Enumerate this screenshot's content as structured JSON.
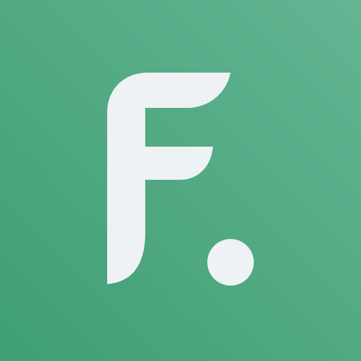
{
  "app_icon": {
    "name": "app-logo",
    "glyph": "F.",
    "colors": {
      "background_start": "#3f9e74",
      "background_end": "#63b593",
      "foreground": "#eff2f4"
    }
  }
}
